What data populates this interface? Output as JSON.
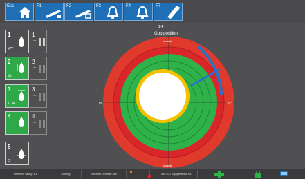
{
  "toolbar": {
    "buttons": [
      {
        "key": "Esc",
        "icon": "home-icon"
      },
      {
        "key": "F1",
        "icon": "chute-icon"
      },
      {
        "key": "F2",
        "icon": "chute-swap-icon"
      },
      {
        "key": "F3",
        "icon": "bell-icon"
      },
      {
        "key": "F4",
        "icon": "bell-ack-icon"
      },
      {
        "key": "F7",
        "icon": "wrench-icon"
      }
    ]
  },
  "section_id": "1-F",
  "side_buttons": [
    {
      "num": "1",
      "sub": "X/Y"
    },
    {
      "num": "2",
      "sub": "Vz"
    },
    {
      "num": "3",
      "sub": "TOA"
    },
    {
      "num": "4",
      "sub": "t"
    },
    {
      "num": "5",
      "sub": "D"
    }
  ],
  "side_secondary": [
    {
      "num": "1",
      "unit": "cm"
    },
    {
      "num": "2",
      "unit": "cm"
    },
    {
      "num": "3",
      "unit": "cm"
    },
    {
      "num": "4",
      "unit": "cm"
    }
  ],
  "chart": {
    "title": "Gob position",
    "label_top": "outside",
    "label_bottom": "outside",
    "label_left": "left",
    "label_right": "right",
    "colors": {
      "outer": "#d8262b",
      "inner": "#2fb24a",
      "gob": "#f5c000",
      "indicator": "#2a72c8"
    }
  },
  "statusbar": {
    "selected": "Selected cavity: 1-F",
    "state": "Moving",
    "machine": "Machine periodic: full",
    "device": "IDE100 Equipment MXX"
  }
}
